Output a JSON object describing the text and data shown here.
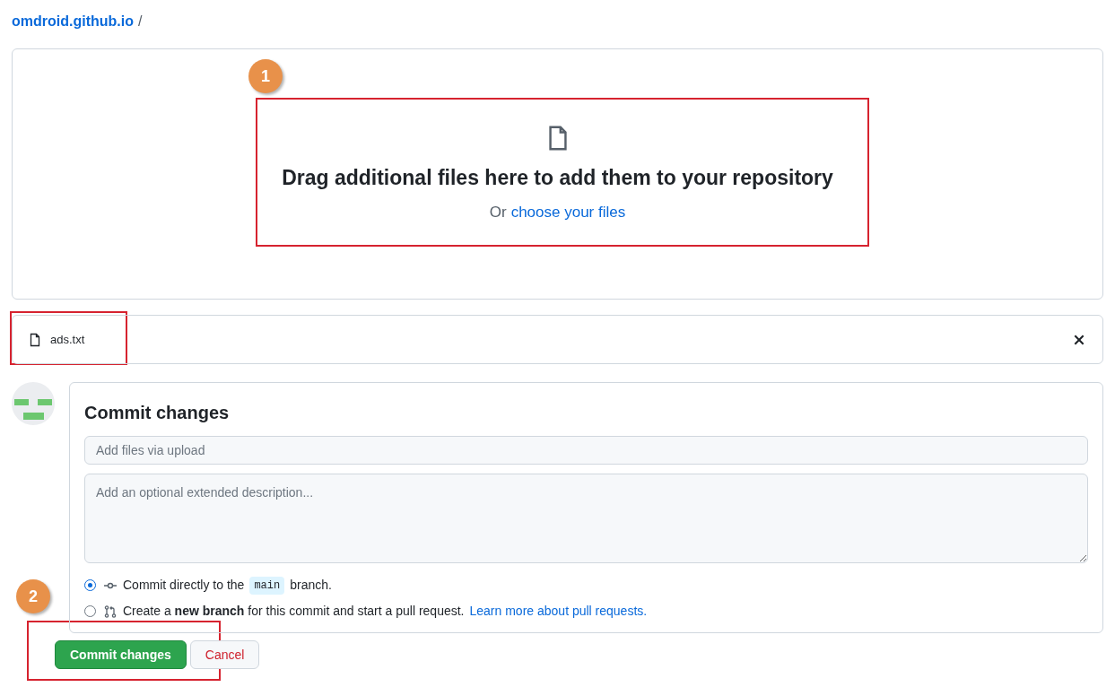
{
  "breadcrumb": {
    "repo": "omdroid.github.io",
    "separator": "/"
  },
  "dropzone": {
    "heading": "Drag additional files here to add them to your repository",
    "prefix": "Or",
    "link": "choose your files"
  },
  "files": [
    {
      "name": "ads.txt"
    }
  ],
  "commit": {
    "title": "Commit changes",
    "summary_placeholder": "Add files via upload",
    "description_placeholder": "Add an optional extended description...",
    "options": [
      {
        "kind": "direct",
        "selected": true,
        "before": "Commit directly to the",
        "code": "main",
        "after": "branch."
      },
      {
        "kind": "new-branch",
        "selected": false,
        "text": "Create a **new branch** for this commit and start a pull request.",
        "link": "Learn more about pull requests."
      }
    ],
    "buttons": [
      {
        "kind": "primary",
        "label": "Commit changes"
      },
      {
        "kind": "secondary",
        "label": "Cancel"
      }
    ]
  },
  "annotations": [
    {
      "number": "1"
    },
    {
      "number": "2"
    }
  ]
}
